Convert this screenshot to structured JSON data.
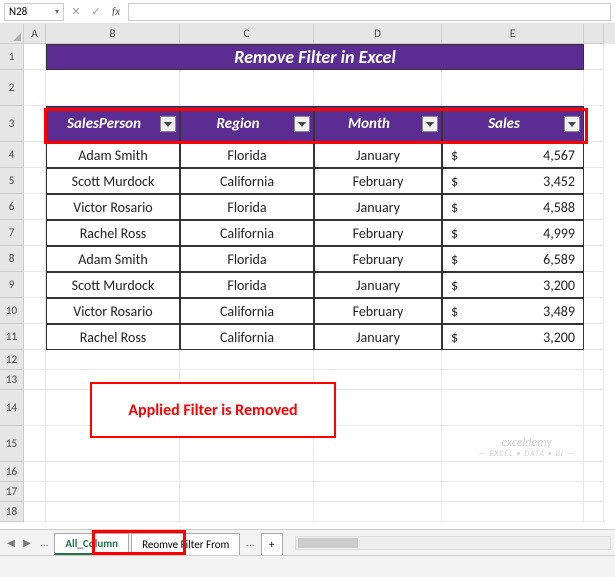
{
  "name_box": "N28",
  "title": "Remove Filter in Excel",
  "columns": [
    "A",
    "B",
    "C",
    "D",
    "E"
  ],
  "column_widths": [
    "cA",
    "cB",
    "cC",
    "cD",
    "cE",
    "cF"
  ],
  "headers": {
    "b": "SalesPerson",
    "c": "Region",
    "d": "Month",
    "e": "Sales"
  },
  "rows": [
    {
      "b": "Adam Smith",
      "c": "Florida",
      "d": "January",
      "e_sym": "$",
      "e_val": "4,567"
    },
    {
      "b": "Scott Murdock",
      "c": "California",
      "d": "February",
      "e_sym": "$",
      "e_val": "3,452"
    },
    {
      "b": "Victor Rosario",
      "c": "Florida",
      "d": "January",
      "e_sym": "$",
      "e_val": "4,588"
    },
    {
      "b": "Rachel Ross",
      "c": "California",
      "d": "February",
      "e_sym": "$",
      "e_val": "4,999"
    },
    {
      "b": "Adam Smith",
      "c": "Florida",
      "d": "February",
      "e_sym": "$",
      "e_val": "6,589"
    },
    {
      "b": "Scott Murdock",
      "c": "Florida",
      "d": "January",
      "e_sym": "$",
      "e_val": "3,200"
    },
    {
      "b": "Victor Rosario",
      "c": "California",
      "d": "February",
      "e_sym": "$",
      "e_val": "3,489"
    },
    {
      "b": "Rachel Ross",
      "c": "California",
      "d": "January",
      "e_sym": "$",
      "e_val": "3,200"
    }
  ],
  "row_nums": [
    "1",
    "2",
    "3",
    "4",
    "5",
    "6",
    "7",
    "8",
    "9",
    "10",
    "11",
    "12",
    "13",
    "14",
    "15",
    "16",
    "17",
    "18"
  ],
  "annotation": "Applied Filter is Removed",
  "watermark": {
    "main": "exceldemy",
    "sub": "— EXCEL • DATA • BI —"
  },
  "tabs": {
    "active": "All_Column",
    "other": "Reomve Filter From",
    "ellipsis": "..."
  }
}
